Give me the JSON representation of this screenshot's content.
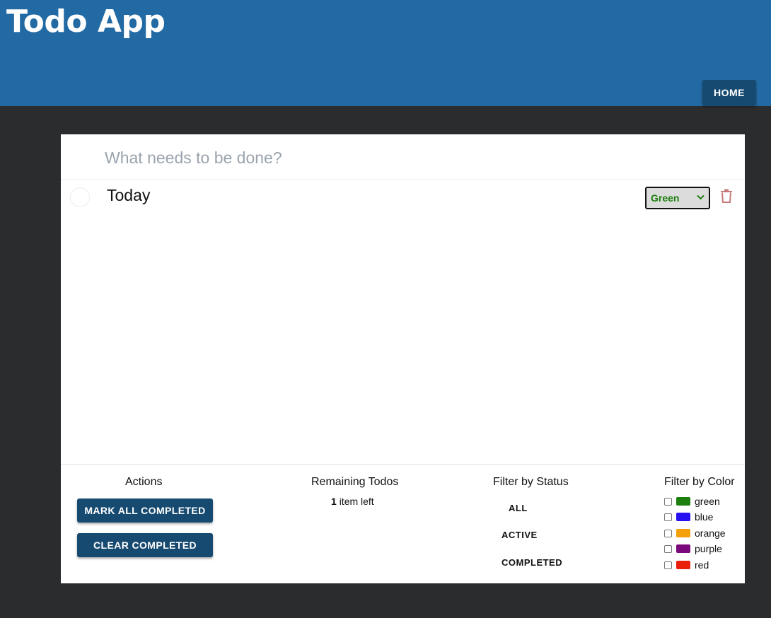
{
  "header": {
    "title": "Todo App",
    "home_label": "HOME"
  },
  "new_todo": {
    "placeholder": "What needs to be done?",
    "value": ""
  },
  "todos": [
    {
      "text": "Today",
      "completed": false,
      "color_label": "Green",
      "color_hex": "#1d7f0e",
      "icon": "trash-icon"
    }
  ],
  "footer": {
    "actions": {
      "title": "Actions",
      "mark_all": "MARK ALL COMPLETED",
      "clear": "CLEAR COMPLETED"
    },
    "remaining": {
      "title": "Remaining Todos",
      "count": "1",
      "suffix": "item left"
    },
    "status": {
      "title": "Filter by Status",
      "options": [
        "ALL",
        "ACTIVE",
        "COMPLETED"
      ]
    },
    "color_filter": {
      "title": "Filter by Color",
      "options": [
        {
          "label": "green",
          "hex": "#1d7f0e",
          "checked": false
        },
        {
          "label": "blue",
          "hex": "#2612f0",
          "checked": false
        },
        {
          "label": "orange",
          "hex": "#f3a00b",
          "checked": false
        },
        {
          "label": "purple",
          "hex": "#7c097c",
          "checked": false
        },
        {
          "label": "red",
          "hex": "#ea1f09",
          "checked": false
        }
      ]
    }
  },
  "colors": {
    "header_bg": "#226aa4",
    "button_bg": "#174a70",
    "page_bg": "#2b2c2e",
    "delete_icon": "#c97b7b"
  }
}
